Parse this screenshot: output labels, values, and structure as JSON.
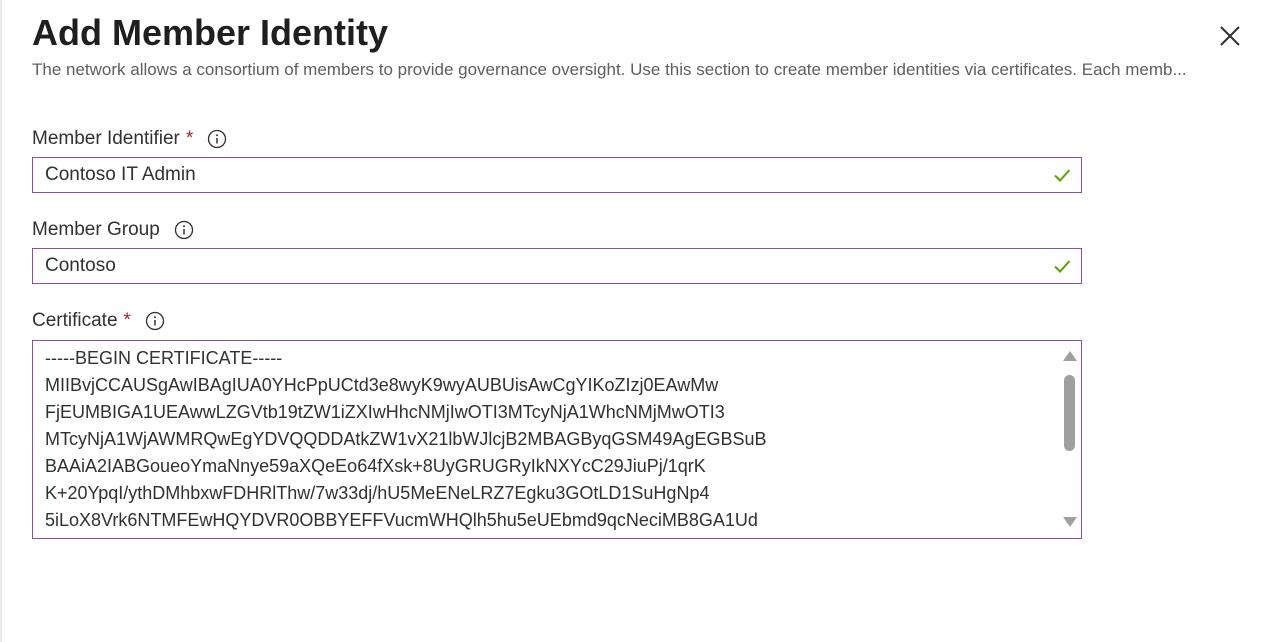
{
  "panel": {
    "title": "Add Member Identity",
    "description": "The network allows a consortium of members to provide governance oversight. Use this section to create member identities via certificates. Each memb...",
    "close_icon": "close-icon"
  },
  "fields": {
    "member_identifier": {
      "label": "Member Identifier",
      "required_mark": "*",
      "value": "Contoso IT Admin",
      "status_icon": "check-icon"
    },
    "member_group": {
      "label": "Member Group",
      "value": "Contoso",
      "status_icon": "check-icon"
    },
    "certificate": {
      "label": "Certificate",
      "required_mark": "*",
      "lines": [
        "-----BEGIN CERTIFICATE-----",
        "MIIBvjCCAUSgAwIBAgIUA0YHcPpUCtd3e8wyK9wyAUBUisAwCgYIKoZIzj0EAwMw",
        "FjEUMBIGA1UEAwwLZGVtb19tZW1iZXIwHhcNMjIwOTI3MTcyNjA1WhcNMjMwOTI3",
        "MTcyNjA1WjAWMRQwEgYDVQQDDAtkZW1vX21lbWJlcjB2MBAGByqGSM49AgEGBSuB",
        "BAAiA2IABGoueoYmaNnye59aXQeEo64fXsk+8UyGRUGRyIkNXYcC29JiuPj/1qrK",
        "K+20YpqI/ythDMhbxwFDHRlThw/7w33dj/hU5MeENeLRZ7Egku3GOtLD1SuHgNp4",
        "5iLoX8Vrk6NTMFEwHQYDVR0OBBYEFFVucmWHQlh5hu5eUEbmd9qcNeciMB8GA1Ud"
      ]
    }
  },
  "colors": {
    "accent_border": "#8a4f9e",
    "required": "#a4262c",
    "valid": "#57a300"
  }
}
